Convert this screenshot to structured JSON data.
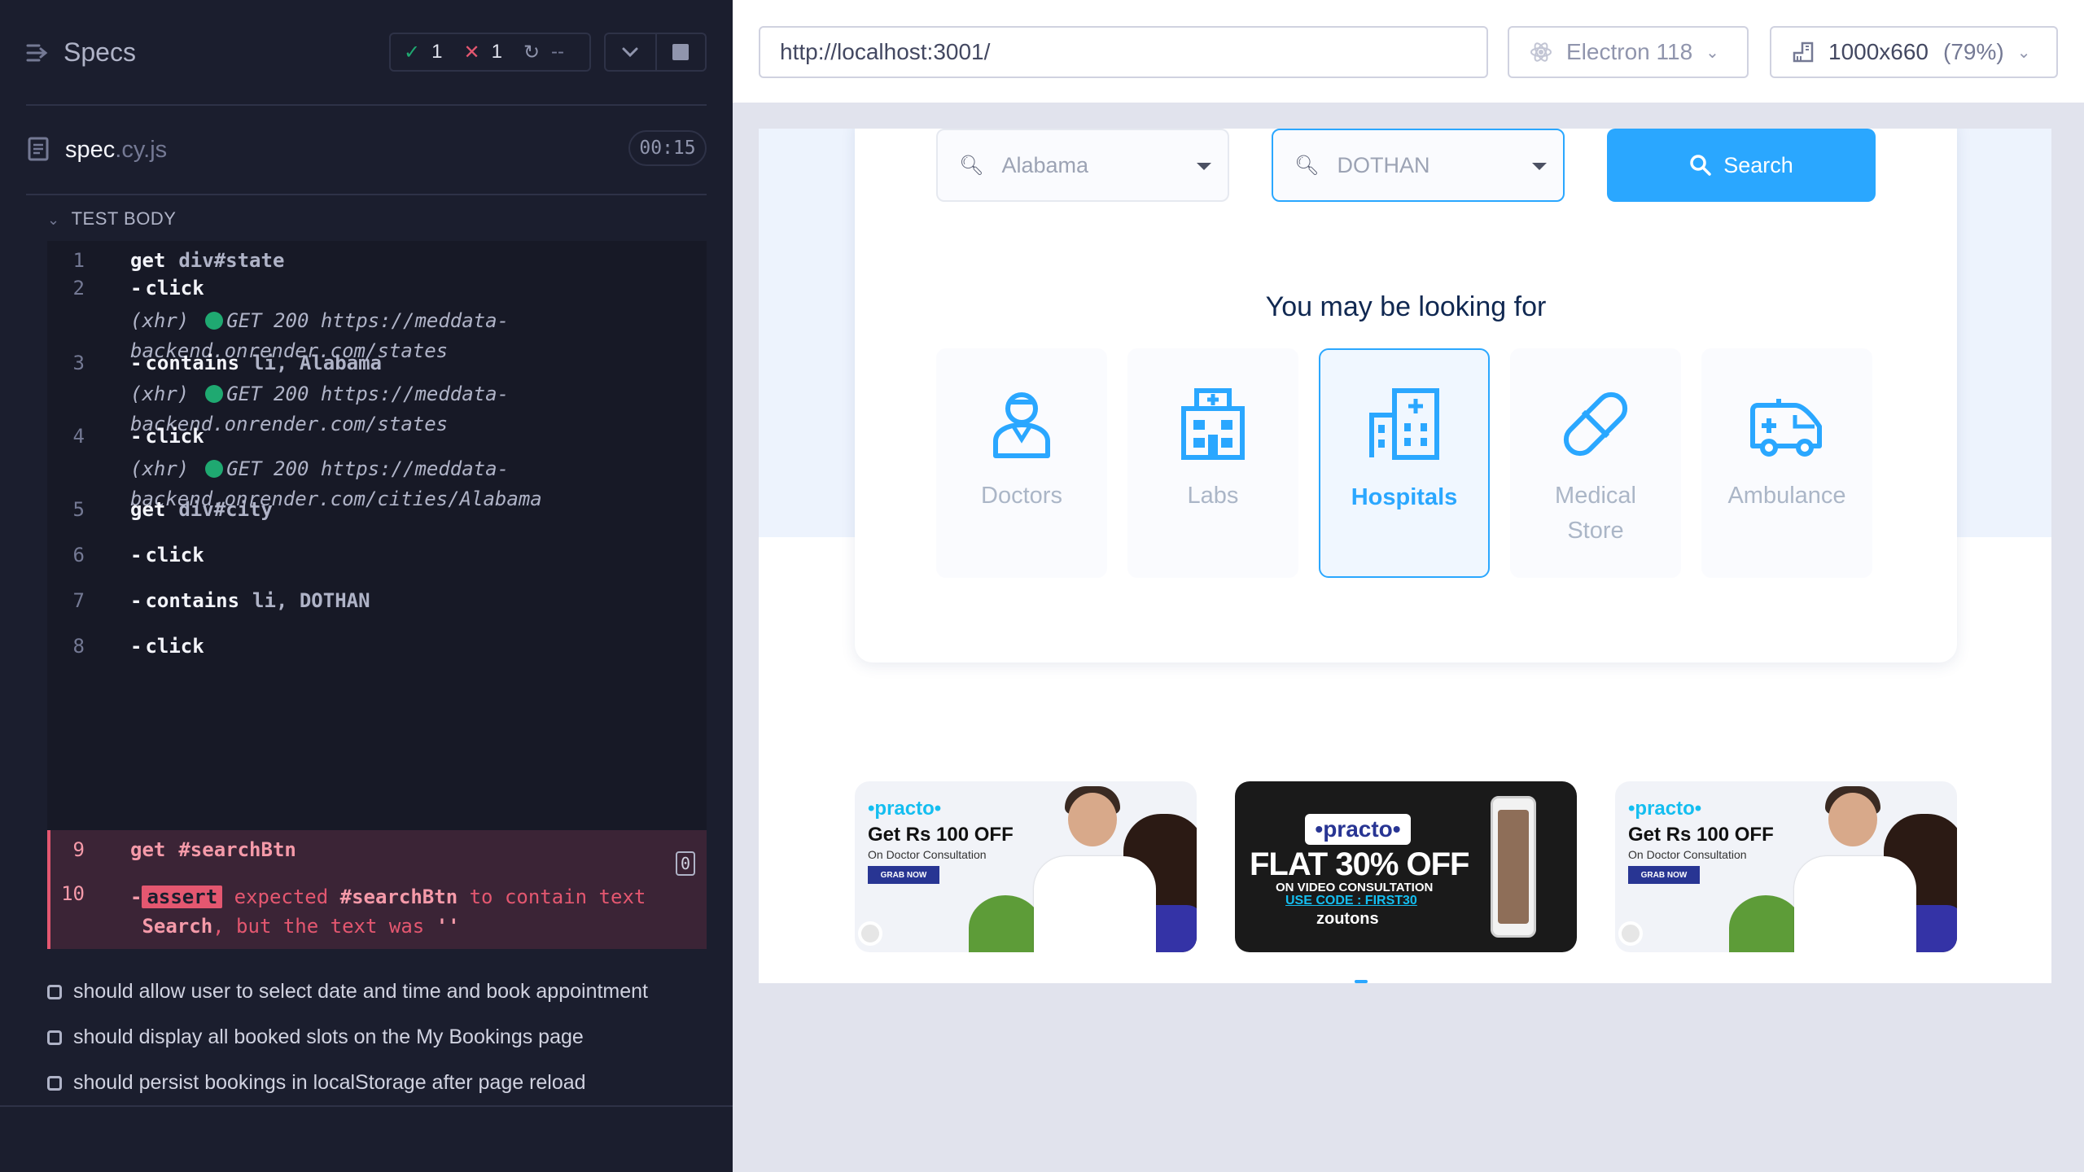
{
  "reporter": {
    "specs_label": "Specs",
    "stats": {
      "passed": "1",
      "failed": "1",
      "pending": "--"
    },
    "spec_file": {
      "name": "spec",
      "ext": ".cy.js"
    },
    "duration": "00:15",
    "test_body_label": "TEST BODY",
    "commands": [
      {
        "num": "1",
        "name": "get",
        "msg": "div#state"
      },
      {
        "num": "2",
        "name": "click",
        "msg": ""
      },
      {
        "num": "3",
        "name": "contains",
        "msg": "li, Alabama"
      },
      {
        "num": "4",
        "name": "click",
        "msg": ""
      },
      {
        "num": "5",
        "name": "get",
        "msg": "div#city"
      },
      {
        "num": "6",
        "name": "click",
        "msg": ""
      },
      {
        "num": "7",
        "name": "contains",
        "msg": "li, DOTHAN"
      },
      {
        "num": "8",
        "name": "click",
        "msg": ""
      },
      {
        "num": "9",
        "name": "get",
        "msg": "#searchBtn",
        "badge": "0"
      }
    ],
    "xhrs": [
      {
        "prefix": "(xhr)",
        "line1": "GET 200 https://meddata-",
        "line2": "backend.onrender.com/states"
      },
      {
        "prefix": "(xhr)",
        "line1": "GET 200 https://meddata-",
        "line2": "backend.onrender.com/states"
      },
      {
        "prefix": "(xhr)",
        "line1": "GET 200 https://meddata-",
        "line2": "backend.onrender.com/cities/Alabama"
      }
    ],
    "failed_command": {
      "num": "10",
      "tag": "assert",
      "w1": "expected",
      "w2": "#searchBtn",
      "w3": "to contain text",
      "w4": "Search",
      "w5": ", but the text was",
      "w6": "''"
    },
    "pending_tests": [
      "should allow user to select date and time and book appointment",
      "should display all booked slots on the My Bookings page",
      "should persist bookings in localStorage after page reload"
    ]
  },
  "toolbar": {
    "url": "http://localhost:3001/",
    "browser": "Electron 118",
    "viewport": "1000x660",
    "viewport_pct": "(79%)"
  },
  "app": {
    "state_value": "Alabama",
    "city_value": "DOTHAN",
    "search_label": "Search",
    "looking_for": "You may be looking for",
    "categories": [
      {
        "line1": "Doctors",
        "line2": ""
      },
      {
        "line1": "Labs",
        "line2": ""
      },
      {
        "line1": "Hospitals",
        "line2": ""
      },
      {
        "line1": "Medical",
        "line2": "Store"
      },
      {
        "line1": "Ambulance",
        "line2": ""
      }
    ],
    "active_category": "Hospitals",
    "offers": [
      {
        "brand": "practo",
        "headline": "Get Rs 100 OFF",
        "sub": "On Doctor Consultation",
        "cta": "GRAB NOW"
      },
      {
        "brand": "practo",
        "headline": "FLAT 30% OFF",
        "sub": "ON VIDEO CONSULTATION",
        "code": "USE CODE : FIRST30",
        "partner": "zoutons"
      },
      {
        "brand": "practo",
        "headline": "Get Rs 100 OFF",
        "sub": "On Doctor Consultation",
        "cta": "GRAB NOW"
      }
    ]
  },
  "colors": {
    "accent": "#2aa7ff",
    "pass": "#1fa971",
    "fail": "#e45770",
    "reporter_bg": "#1b1e2e"
  }
}
